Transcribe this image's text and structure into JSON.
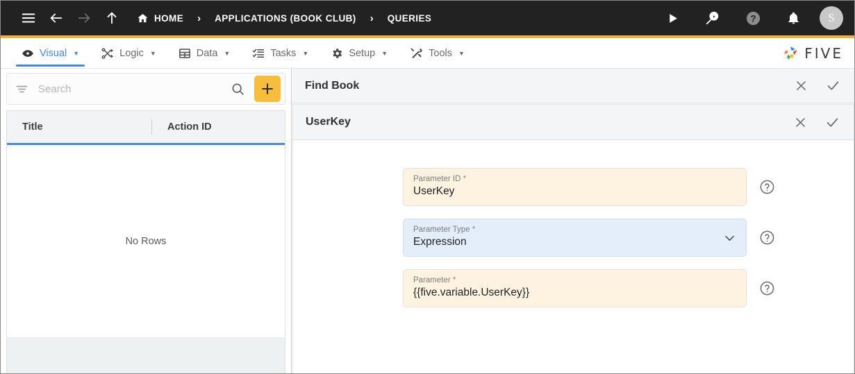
{
  "topbar": {
    "menu_icon": "hamburger-menu-icon",
    "back_icon": "arrow-left-icon",
    "forward_icon": "arrow-right-icon",
    "up_icon": "arrow-up-icon",
    "breadcrumbs": [
      {
        "label": "HOME",
        "icon": "home-icon"
      },
      {
        "label": "APPLICATIONS (BOOK CLUB)",
        "icon": ""
      },
      {
        "label": "QUERIES",
        "icon": ""
      }
    ],
    "separator": "›",
    "actions": [
      {
        "name": "run-icon",
        "glyph": "play"
      },
      {
        "name": "search-run-icon",
        "glyph": "search-play"
      },
      {
        "name": "help-icon",
        "glyph": "question"
      },
      {
        "name": "notifications-icon",
        "glyph": "bell"
      }
    ],
    "avatar_initial": "S",
    "accent_color": "#F2B134",
    "background_color": "#222222"
  },
  "tabbar": {
    "tabs": [
      {
        "label": "Visual",
        "icon": "eye-icon",
        "active": true
      },
      {
        "label": "Logic",
        "icon": "flow-icon",
        "active": false
      },
      {
        "label": "Data",
        "icon": "grid-icon",
        "active": false
      },
      {
        "label": "Tasks",
        "icon": "checklist-icon",
        "active": false
      },
      {
        "label": "Setup",
        "icon": "gear-icon",
        "active": false
      },
      {
        "label": "Tools",
        "icon": "tools-icon",
        "active": false
      }
    ],
    "caret": "▼",
    "active_color": "#4285F4",
    "brand": "FIVE"
  },
  "left_panel": {
    "search": {
      "placeholder": "Search",
      "value": ""
    },
    "filter_icon": "filter-icon",
    "search_icon": "search-icon",
    "add_button_label": "+",
    "add_button_color": "#F7BE3C",
    "grid": {
      "columns": [
        "Title",
        "Action ID"
      ],
      "rows": [],
      "empty_message": "No Rows",
      "header_underline_color": "#4285F4"
    }
  },
  "right_panel": {
    "panels": [
      {
        "title": "Find Book",
        "close_icon": "close-icon",
        "confirm_icon": "check-icon"
      },
      {
        "title": "UserKey",
        "close_icon": "close-icon",
        "confirm_icon": "check-icon"
      }
    ],
    "fields": [
      {
        "label": "Parameter ID",
        "required_mark": "*",
        "value": "UserKey",
        "style": "cream",
        "dropdown": false,
        "help_icon": "help-circle-icon"
      },
      {
        "label": "Parameter Type",
        "required_mark": "*",
        "value": "Expression",
        "style": "blue",
        "dropdown": true,
        "help_icon": "help-circle-icon"
      },
      {
        "label": "Parameter",
        "required_mark": "*",
        "value": "{{five.variable.UserKey}}",
        "style": "cream",
        "dropdown": false,
        "help_icon": "help-circle-icon"
      }
    ]
  }
}
